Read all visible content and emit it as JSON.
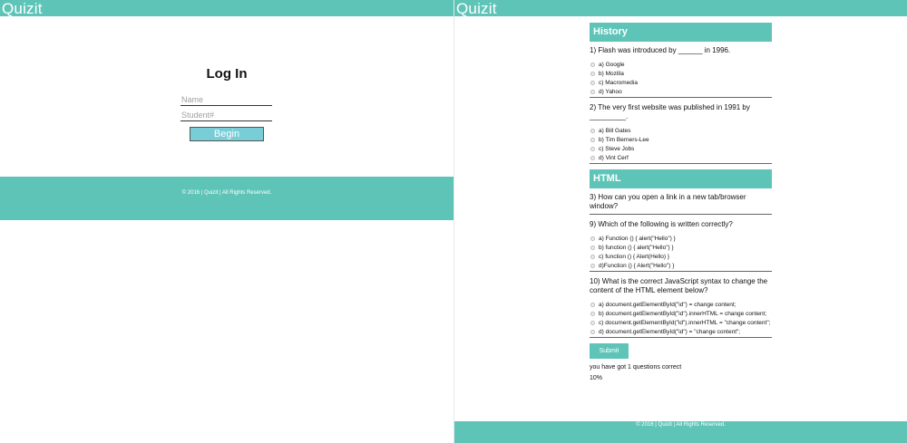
{
  "left": {
    "brand": "Quizit",
    "title": "Log In",
    "name_placeholder": "Name",
    "student_placeholder": "Student#",
    "begin_label": "Begin",
    "footer": "© 2016 | Quizit | All Rights Reserved."
  },
  "right": {
    "brand": "Quizit",
    "sections": {
      "history": "History",
      "html": "HTML"
    },
    "questions": [
      {
        "text": "1) Flash was introduced by ______ in 1996.",
        "options": [
          "a) Google",
          "b) Mozilla",
          "c) Macromedia",
          "d) Yahoo"
        ]
      },
      {
        "text": "2) The very first website was published in 1991 by _________.",
        "options": [
          "a) Bill Gates",
          "b) Tim Berners-Lee",
          "c) Steve Jobs",
          "d) Vint Cerf"
        ]
      },
      {
        "text": "3) How can you open a link in a new tab/browser window?"
      },
      {
        "text": "9) Which of the following is written correctly?",
        "options": [
          "a) Function () { alert(\"Hello\") }",
          "b) function () { alert(\"Hello\") }",
          "c) function () { Alert(Hello) }",
          "d)Function () { Alert(\"Hello\") }"
        ]
      },
      {
        "text": "10) What is the correct JavaScript syntax to change the content of the HTML element below?",
        "options": [
          "a) document.getElementById(\"id\") = change content;",
          "b) document.getElementById(\"id\").innerHTML = change content;",
          "c) document.getElementById(\"id\").innerHTML = \"change content\";",
          "d) document.getElementById(\"id\") = \"change content\";"
        ]
      }
    ],
    "submit_label": "Submit",
    "result_text": "you have got 1 questions correct",
    "score_text": "10%",
    "footer": "© 2016 | Quizit | All Rights Reserved."
  }
}
